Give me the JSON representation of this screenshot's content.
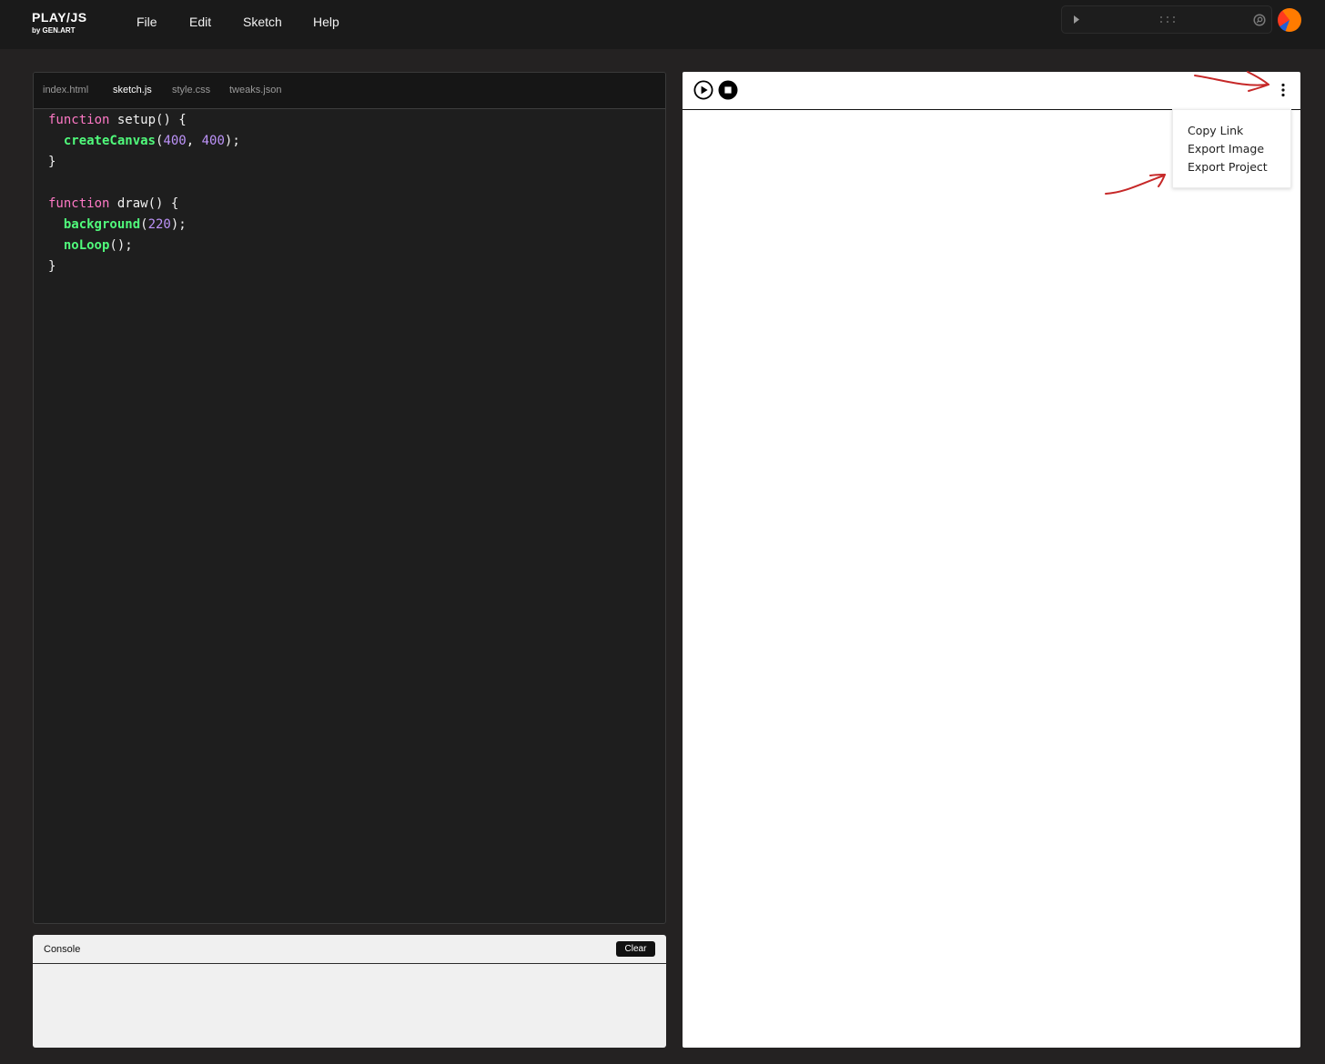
{
  "app": {
    "logo_main": "PLAY/JS",
    "logo_sub": "by GEN.ART"
  },
  "menubar": {
    "items": [
      "File",
      "Edit",
      "Sketch",
      "Help"
    ]
  },
  "editor": {
    "tabs": [
      {
        "label": "index.html",
        "active": false
      },
      {
        "label": "sketch.js",
        "active": true
      },
      {
        "label": "style.css",
        "active": false
      },
      {
        "label": "tweaks.json",
        "active": false
      }
    ],
    "code_lines": [
      [
        "function",
        " setup() {"
      ],
      [
        "createCanvas",
        "(",
        "400",
        ", ",
        "400",
        ");"
      ],
      [
        "}"
      ],
      [],
      [
        "function",
        " draw() {"
      ],
      [
        "background",
        "(",
        "220",
        ");"
      ],
      [
        "noLoop",
        "();"
      ],
      [
        "}"
      ]
    ]
  },
  "console": {
    "title": "Console",
    "clear_label": "Clear"
  },
  "preview": {
    "menu": {
      "items": [
        "Copy Link",
        "Export Image",
        "Export Project"
      ]
    }
  },
  "icons": {
    "command_bar": [
      "play-triangle-icon",
      "grid-dots-icon",
      "search-icon"
    ],
    "avatar": "user-avatar",
    "preview_toolbar": [
      "play-circle-icon",
      "stop-circle-icon",
      "more-vertical-icon"
    ],
    "annotations": [
      "red-arrow-annotation",
      "red-arrow-annotation"
    ]
  },
  "colors": {
    "header_bg": "#1a1a1a",
    "page_bg": "#242222",
    "editor_bg": "#1e1e1e",
    "syntax_keyword": "#ff79c6",
    "syntax_function": "#50fa7b",
    "syntax_number": "#bd93f9",
    "console_bg": "#f0f0f0",
    "annotation_red": "#c62828"
  }
}
